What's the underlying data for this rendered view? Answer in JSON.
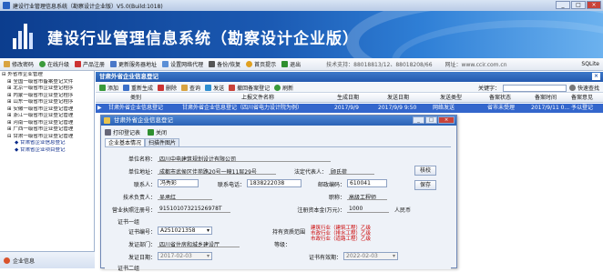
{
  "window": {
    "title": "建设行业管理信息系统（勘察设计企业版）V5.0(Build:1018)",
    "min": "_",
    "max": "□",
    "close": "×"
  },
  "banner": {
    "title": "建设行业管理信息系统（勘察设计企业版）",
    "logo_text": "CCIR"
  },
  "toolbar": {
    "items": [
      "修改密码",
      "在线升级",
      "产品注册",
      "更新服务器地址",
      "设置网络代理",
      "备份/恢复",
      "首页提示",
      "退出"
    ],
    "tech_support": "技术支持：88018813/12、88018208/66",
    "website": "网址：www.ccir.com.cn",
    "db": "SQLite"
  },
  "sidebar": {
    "items": [
      "外省市企业管理",
      "全国一级省市备案登记文件",
      "北京一级省市企业登记程序",
      "内蒙一级省市企业登记程序",
      "山东一级省市企业登记程序",
      "安徽一级省市企业登记管理",
      "浙江一级省市企业登记管理",
      "河南一级省市企业登记管理",
      "广西一级省市企业登记管理",
      "甘肃一级省市企业登记管理",
      "甘肃省企业信息登记",
      "甘肃省企业项目登记"
    ],
    "bottom": "企业信息"
  },
  "panel": {
    "title": "甘肃外省企业信息登记"
  },
  "main_toolbar": {
    "items": [
      "添加",
      "重新生成",
      "删除",
      "查询",
      "发送",
      "撤回备案登记",
      "刷新"
    ],
    "keyword_label": "关键字：",
    "quick_search": "快速查找"
  },
  "table": {
    "headers": [
      "类别",
      "上报文件名称",
      "生成日期",
      "发送日期",
      "发送类型",
      "备案状态",
      "备案时间",
      "备案意见"
    ],
    "row": [
      "甘肃外省企业信息登记",
      "甘肃外省企业信息登记（四川省电力设计院为例）",
      "2017/9/9",
      "2017/9/9 9:50",
      "网络发送",
      "省市未受理",
      "2017/9/11 0...",
      "予以登记"
    ]
  },
  "dialog": {
    "title": "甘肃外省企业信息登记",
    "print": "打印登记表",
    "close": "关闭",
    "tabs": [
      "企业基本情况",
      "扫描件图片"
    ],
    "fields": {
      "unit_name_label": "单位名称：",
      "unit_name": "四川中电建筑规划设计有限公司",
      "address_label": "单位地址：",
      "address": "成都市武侯区佳苑路20号一幢11层29号",
      "legal_label": "法定代表人：",
      "legal": "顾氏荷",
      "contact_label": "联系人：",
      "contact": "冯秀彩",
      "phone_label": "联系电话：",
      "phone": "1838222038",
      "zip_label": "邮政编码：",
      "zip": "610041",
      "tech_label": "技术负责人：",
      "tech": "吴承红",
      "title_label": "职称：",
      "title": "高级工程师",
      "license_label": "营业执照注册号：",
      "license": "91510107321526978T",
      "capital_label": "注册资本金(万元)：",
      "capital": "1000",
      "capital_unit": "人民币",
      "cert_section": "证书一组",
      "cert_no_label": "证书编号：",
      "cert_no": "A251021358",
      "scope_label": "持有资质范围",
      "scope_lines": [
        "建筑行业（建筑工程）乙级",
        "市政行业（排水工程）乙级",
        "市政行业（道路工程）乙级"
      ],
      "issuer_label": "发证部门：",
      "issuer": "四川省住房和城乡建设厅",
      "grade_label": "等级：",
      "issue_date_label": "发证日期：",
      "issue_date": "2017-02-03",
      "expire_label": "证书有效期：",
      "expire": "2022-02-03",
      "cert_section2": "证书二组"
    },
    "btn_verify": "核校",
    "btn_save": "保存"
  }
}
